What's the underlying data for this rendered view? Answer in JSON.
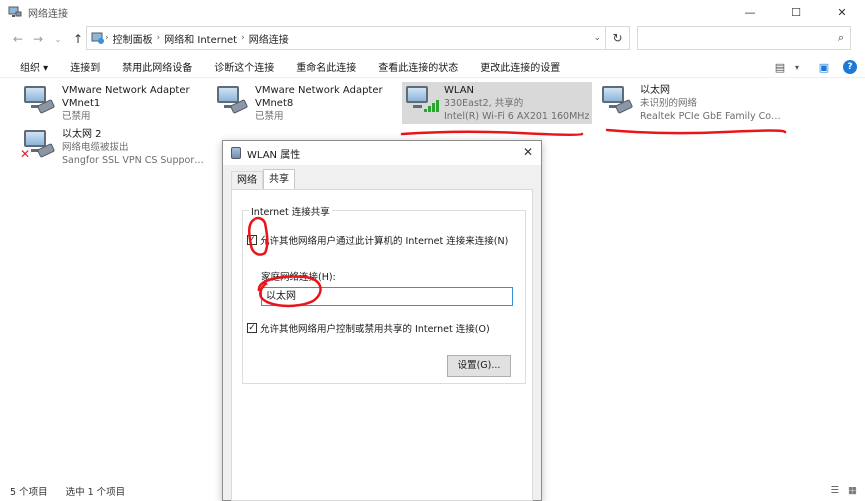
{
  "window": {
    "title": "网络连接",
    "minimize": "—",
    "maximize": "☐",
    "close": "✕"
  },
  "address": {
    "crumbs": [
      "控制面板",
      "网络和 Internet",
      "网络连接"
    ],
    "search_placeholder": ""
  },
  "toolbar": {
    "items": [
      "组织 ▾",
      "连接到",
      "禁用此网络设备",
      "诊断这个连接",
      "重命名此连接",
      "查看此连接的状态",
      "更改此连接的设置"
    ]
  },
  "connections": [
    {
      "name": "VMware Network Adapter VMnet1",
      "line1": "VMware Network Adapter",
      "line2": "VMnet1",
      "status": "已禁用",
      "device": ""
    },
    {
      "name": "VMware Network Adapter VMnet8",
      "line1": "VMware Network Adapter",
      "line2": "VMnet8",
      "status": "已禁用",
      "device": ""
    },
    {
      "name": "WLAN",
      "line1": "WLAN",
      "line2": "",
      "status": "330East2, 共享的",
      "device": "Intel(R) Wi-Fi 6 AX201 160MHz"
    },
    {
      "name": "以太网",
      "line1": "以太网",
      "line2": "",
      "status": "未识别的网络",
      "device": "Realtek PCIe GbE Family Contr..."
    },
    {
      "name": "以太网 2",
      "line1": "以太网 2",
      "line2": "",
      "status": "网络电缆被拔出",
      "device": "Sangfor SSL VPN CS Support S..."
    }
  ],
  "statusbar": {
    "count": "5 个项目",
    "selected": "选中 1 个项目"
  },
  "dialog": {
    "title": "WLAN 属性",
    "tabs": [
      "网络",
      "共享"
    ],
    "group_title": "Internet 连接共享",
    "allow_share": {
      "label": "允许其他网络用户通过此计算机的 Internet 连接来连接(N)",
      "checked": true
    },
    "home_label": "家庭网络连接(H):",
    "home_value": "以太网",
    "allow_control": {
      "label": "允许其他网络用户控制或禁用共享的 Internet 连接(O)",
      "checked": true
    },
    "settings_button": "设置(G)..."
  },
  "colors": {
    "selection": "#cce8ff",
    "annotation": "#e8161b",
    "accent": "#1e78d6"
  }
}
